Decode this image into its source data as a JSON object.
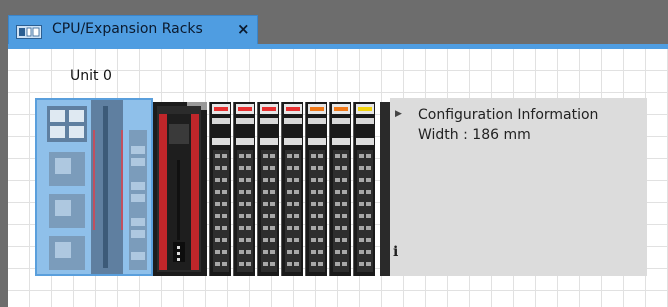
{
  "tab": {
    "icon": "rack-config-icon",
    "title": "CPU/Expansion Racks",
    "close_symbol": "×"
  },
  "rack": {
    "unit_label": "Unit 0",
    "io_units": [
      {
        "indicator_color": "#e83030"
      },
      {
        "indicator_color": "#e83030"
      },
      {
        "indicator_color": "#e83030"
      },
      {
        "indicator_color": "#e83030"
      },
      {
        "indicator_color": "#f07818"
      },
      {
        "indicator_color": "#f07818"
      },
      {
        "indicator_color": "#f2d40e"
      }
    ]
  },
  "info_panel": {
    "expand_icon": "expand-arrow-icon",
    "line1": "Configuration Information",
    "line2": "Width : 186 mm",
    "info_symbol": "i"
  },
  "colors": {
    "tab_accent": "#4f9de1",
    "selection": "#8fc0ea",
    "module_red": "#c0262a"
  }
}
